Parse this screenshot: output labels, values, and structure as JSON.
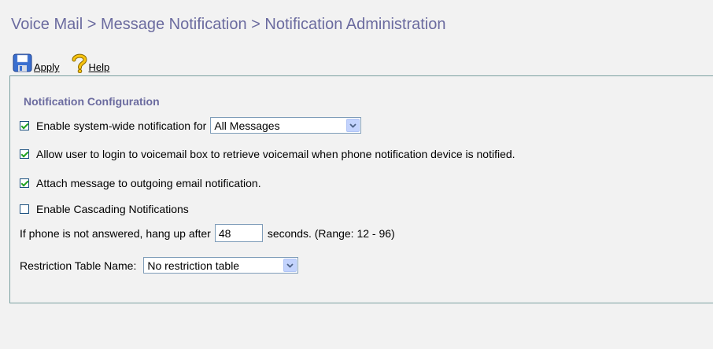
{
  "header": {
    "title": "Voice Mail > Message Notification > Notification Administration"
  },
  "toolbar": {
    "apply_label": "Apply",
    "apply_icon": "save-icon",
    "help_label": "Help",
    "help_icon": "question-mark-icon"
  },
  "section": {
    "title": "Notification Configuration",
    "system_wide": {
      "checked": true,
      "label": "Enable system-wide notification for",
      "selected": "All Messages"
    },
    "allow_login": {
      "checked": true,
      "label": "Allow user to login to voicemail box to retrieve voicemail when phone notification device is notified."
    },
    "attach_message": {
      "checked": true,
      "label": "Attach message to outgoing email notification."
    },
    "cascading": {
      "checked": false,
      "label": "Enable Cascading Notifications"
    },
    "hangup": {
      "label_before": "If phone is not answered, hang up after",
      "value": "48",
      "label_after": "seconds. (Range: 12 - 96)"
    },
    "restriction": {
      "label": "Restriction Table Name:",
      "selected": "No restriction table"
    }
  },
  "colors": {
    "title": "#6b6b9f",
    "panel_border": "#7aa0a0",
    "background": "#f2f2f2",
    "checkmark": "#21a121"
  }
}
